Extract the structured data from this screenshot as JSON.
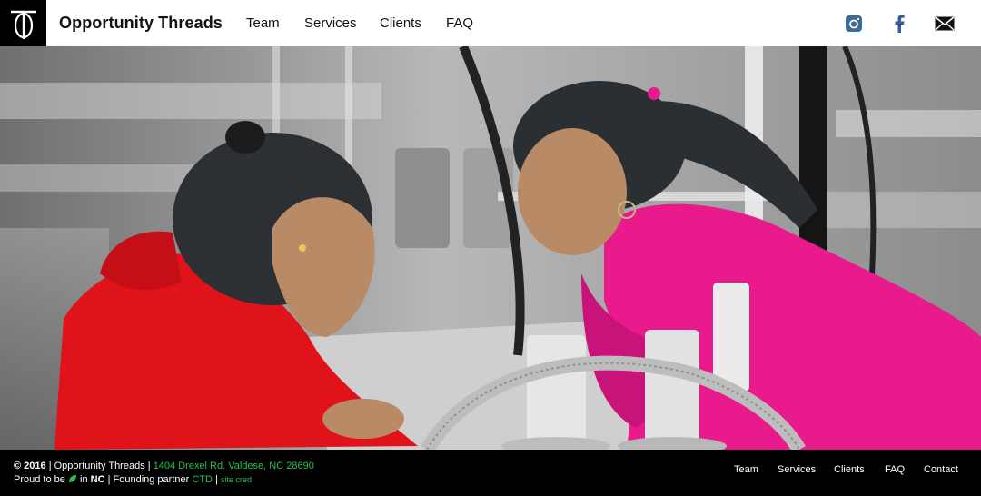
{
  "header": {
    "logo_letters": "TO",
    "brand": "Opportunity Threads",
    "nav": [
      "Team",
      "Services",
      "Clients",
      "FAQ"
    ],
    "social": [
      "instagram-icon",
      "facebook-icon",
      "mail-icon"
    ]
  },
  "colors": {
    "accent_green": "#2fbf4f",
    "red_hoodie": "#e0121a",
    "pink_shirt": "#e81a8c",
    "footer_bg": "#000000"
  },
  "footer": {
    "copyright": "© 2016",
    "org": "Opportunity Threads",
    "address": "1404 Drexel Rd. Valdese, NC 28690",
    "proud_prefix": "Proud to be",
    "proud_mid": "in",
    "state": "NC",
    "partner_prefix": "Founding partner",
    "partner": "CTD",
    "site_cred": "site cred",
    "sep": "|",
    "nav": [
      "Team",
      "Services",
      "Clients",
      "FAQ",
      "Contact"
    ]
  }
}
